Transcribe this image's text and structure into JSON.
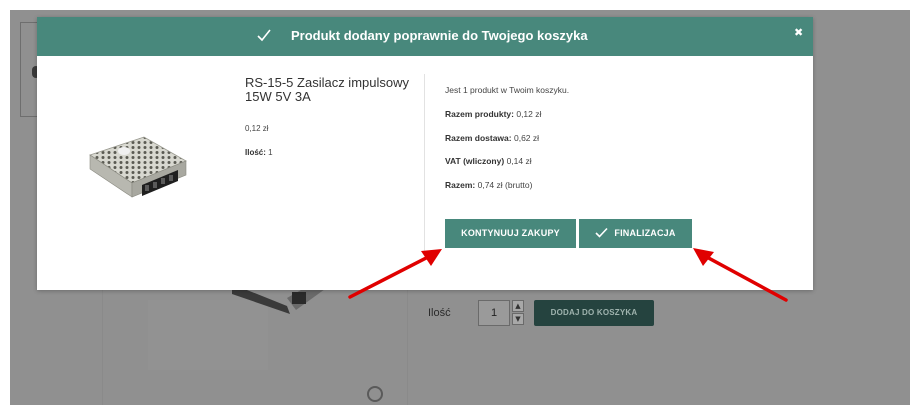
{
  "colors": {
    "teal": "#48887c",
    "teal_dark": "#25433f",
    "arrow_red": "#e00000",
    "overlay": "#787878"
  },
  "background_page": {
    "quantity_label": "Ilość",
    "quantity_value": "1",
    "add_to_cart_label": "DODAJ DO KOSZYKA",
    "spinner_up": "▲",
    "spinner_down": "▼"
  },
  "modal": {
    "header": {
      "check_icon": "check-icon",
      "title": "Produkt dodany poprawnie do Twojego koszyka",
      "close_icon": "close-icon",
      "close_glyph": "✖"
    },
    "product": {
      "image_icon": "power-supply-image",
      "name": "RS-15-5 Zasilacz impulsowy 15W 5V 3A",
      "price": "0,12 zł",
      "quantity_label": "Ilość:",
      "quantity_value": "1"
    },
    "summary": {
      "items_in_cart": "Jest 1 produkt w Twoim koszyku.",
      "total_products_label": "Razem produkty:",
      "total_products_value": "0,12 zł",
      "total_shipping_label": "Razem dostawa:",
      "total_shipping_value": "0,62 zł",
      "vat_label": "VAT (wliczony)",
      "vat_value": "0,14 zł",
      "total_label": "Razem:",
      "total_value": "0,74 zł (brutto)"
    },
    "buttons": {
      "continue_label": "KONTYNUUJ ZAKUPY",
      "finalize_label": "FINALIZACJA",
      "finalize_icon": "check-icon"
    }
  },
  "annotations": {
    "arrow_icons": [
      "red-arrow-icon",
      "red-arrow-icon"
    ]
  }
}
